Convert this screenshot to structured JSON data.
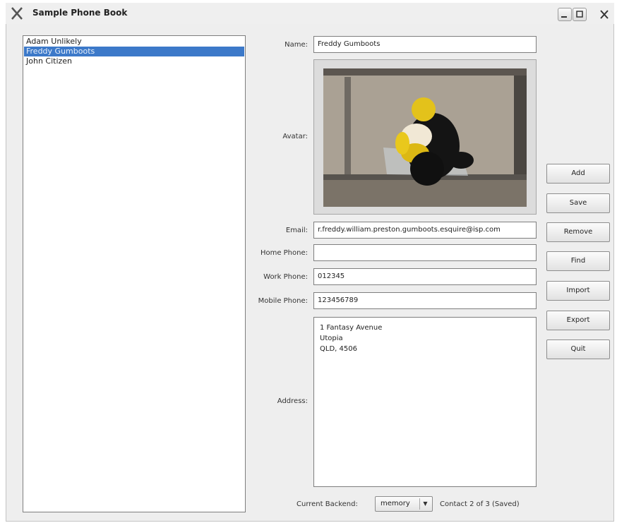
{
  "window": {
    "title": "Sample Phone Book",
    "logo_icon": "x-logo-icon",
    "minimize_icon": "minimize-icon",
    "maximize_icon": "maximize-icon",
    "close_icon": "close-icon"
  },
  "contacts": [
    {
      "name": "Adam Unlikely",
      "selected": false
    },
    {
      "name": "Freddy Gumboots",
      "selected": true
    },
    {
      "name": "John Citizen",
      "selected": false
    }
  ],
  "form": {
    "name_label": "Name:",
    "name_value": "Freddy Gumboots",
    "avatar_label": "Avatar:",
    "email_label": "Email:",
    "email_value": "r.freddy.william.preston.gumboots.esquire@isp.com",
    "home_phone_label": "Home Phone:",
    "home_phone_value": "",
    "work_phone_label": "Work Phone:",
    "work_phone_value": "012345",
    "mobile_phone_label": "Mobile Phone:",
    "mobile_phone_value": "123456789",
    "address_label": "Address:",
    "address_lines": [
      "1 Fantasy Avenue",
      "Utopia",
      "QLD, 4506"
    ]
  },
  "buttons": {
    "add": "Add",
    "save": "Save",
    "remove": "Remove",
    "find": "Find",
    "import": "Import",
    "export": "Export",
    "quit": "Quit"
  },
  "status": {
    "backend_label": "Current Backend:",
    "backend_value": "memory",
    "contact_status": "Contact 2 of 3 (Saved)"
  },
  "colors": {
    "selection": "#3c79c9",
    "window_bg": "#eeeeee"
  }
}
